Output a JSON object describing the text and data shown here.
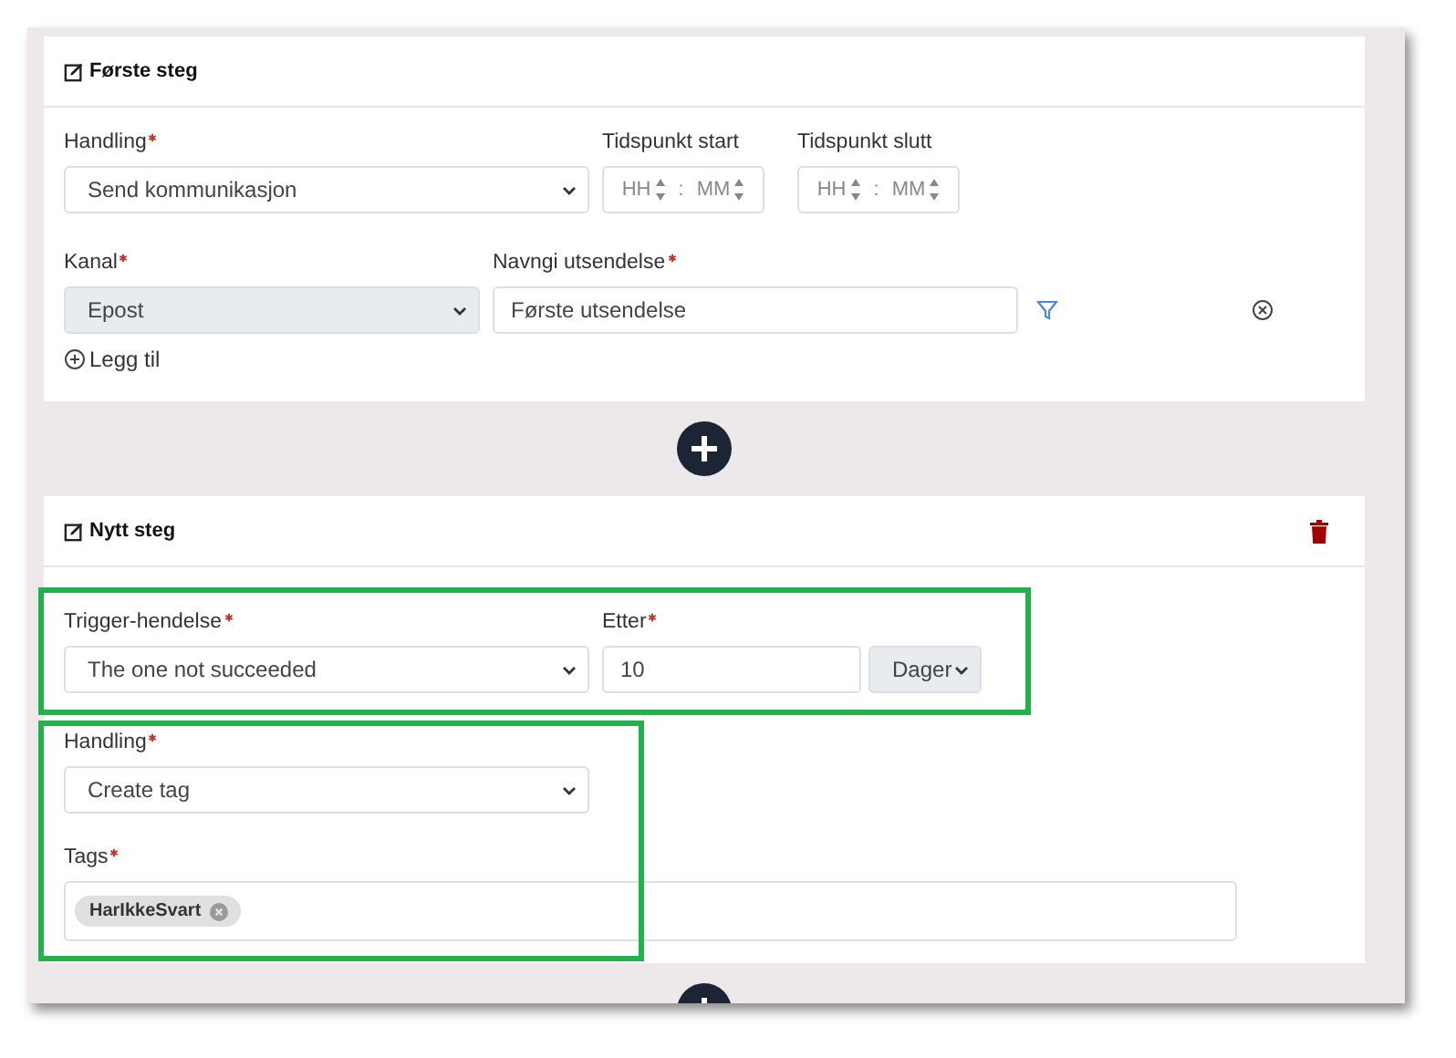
{
  "first_step": {
    "title": "Første steg",
    "action": {
      "label": "Handling",
      "required": true,
      "value": "Send kommunikasjon"
    },
    "time_start": {
      "label": "Tidspunkt start",
      "hour": "HH",
      "minute": "MM",
      "separator": ":"
    },
    "time_end": {
      "label": "Tidspunkt slutt",
      "hour": "HH",
      "minute": "MM",
      "separator": ":"
    },
    "channel": {
      "label": "Kanal",
      "required": true,
      "value": "Epost",
      "disabled": true
    },
    "name": {
      "label": "Navngi utsendelse",
      "required": true,
      "value": "Første utsendelse"
    },
    "add_link": "Legg til"
  },
  "new_step": {
    "title": "Nytt steg",
    "trigger": {
      "label": "Trigger-hendelse",
      "required": true,
      "value": "The one not succeeded"
    },
    "after": {
      "label": "Etter",
      "required": true,
      "value": "10",
      "unit": "Dager"
    },
    "action": {
      "label": "Handling",
      "required": true,
      "value": "Create tag"
    },
    "tags": {
      "label": "Tags",
      "required": true,
      "items": [
        "HarIkkeSvart"
      ]
    }
  }
}
